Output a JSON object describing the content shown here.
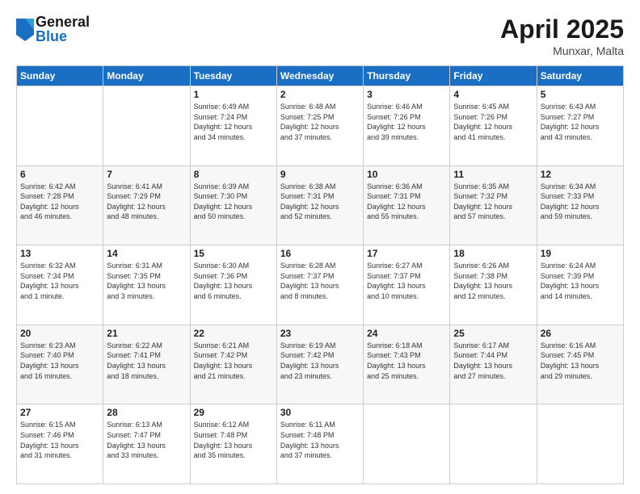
{
  "header": {
    "logo_general": "General",
    "logo_blue": "Blue",
    "title": "April 2025",
    "subtitle": "Munxar, Malta"
  },
  "days_of_week": [
    "Sunday",
    "Monday",
    "Tuesday",
    "Wednesday",
    "Thursday",
    "Friday",
    "Saturday"
  ],
  "weeks": [
    [
      {
        "day": "",
        "info": ""
      },
      {
        "day": "",
        "info": ""
      },
      {
        "day": "1",
        "info": "Sunrise: 6:49 AM\nSunset: 7:24 PM\nDaylight: 12 hours\nand 34 minutes."
      },
      {
        "day": "2",
        "info": "Sunrise: 6:48 AM\nSunset: 7:25 PM\nDaylight: 12 hours\nand 37 minutes."
      },
      {
        "day": "3",
        "info": "Sunrise: 6:46 AM\nSunset: 7:26 PM\nDaylight: 12 hours\nand 39 minutes."
      },
      {
        "day": "4",
        "info": "Sunrise: 6:45 AM\nSunset: 7:26 PM\nDaylight: 12 hours\nand 41 minutes."
      },
      {
        "day": "5",
        "info": "Sunrise: 6:43 AM\nSunset: 7:27 PM\nDaylight: 12 hours\nand 43 minutes."
      }
    ],
    [
      {
        "day": "6",
        "info": "Sunrise: 6:42 AM\nSunset: 7:28 PM\nDaylight: 12 hours\nand 46 minutes."
      },
      {
        "day": "7",
        "info": "Sunrise: 6:41 AM\nSunset: 7:29 PM\nDaylight: 12 hours\nand 48 minutes."
      },
      {
        "day": "8",
        "info": "Sunrise: 6:39 AM\nSunset: 7:30 PM\nDaylight: 12 hours\nand 50 minutes."
      },
      {
        "day": "9",
        "info": "Sunrise: 6:38 AM\nSunset: 7:31 PM\nDaylight: 12 hours\nand 52 minutes."
      },
      {
        "day": "10",
        "info": "Sunrise: 6:36 AM\nSunset: 7:31 PM\nDaylight: 12 hours\nand 55 minutes."
      },
      {
        "day": "11",
        "info": "Sunrise: 6:35 AM\nSunset: 7:32 PM\nDaylight: 12 hours\nand 57 minutes."
      },
      {
        "day": "12",
        "info": "Sunrise: 6:34 AM\nSunset: 7:33 PM\nDaylight: 12 hours\nand 59 minutes."
      }
    ],
    [
      {
        "day": "13",
        "info": "Sunrise: 6:32 AM\nSunset: 7:34 PM\nDaylight: 13 hours\nand 1 minute."
      },
      {
        "day": "14",
        "info": "Sunrise: 6:31 AM\nSunset: 7:35 PM\nDaylight: 13 hours\nand 3 minutes."
      },
      {
        "day": "15",
        "info": "Sunrise: 6:30 AM\nSunset: 7:36 PM\nDaylight: 13 hours\nand 6 minutes."
      },
      {
        "day": "16",
        "info": "Sunrise: 6:28 AM\nSunset: 7:37 PM\nDaylight: 13 hours\nand 8 minutes."
      },
      {
        "day": "17",
        "info": "Sunrise: 6:27 AM\nSunset: 7:37 PM\nDaylight: 13 hours\nand 10 minutes."
      },
      {
        "day": "18",
        "info": "Sunrise: 6:26 AM\nSunset: 7:38 PM\nDaylight: 13 hours\nand 12 minutes."
      },
      {
        "day": "19",
        "info": "Sunrise: 6:24 AM\nSunset: 7:39 PM\nDaylight: 13 hours\nand 14 minutes."
      }
    ],
    [
      {
        "day": "20",
        "info": "Sunrise: 6:23 AM\nSunset: 7:40 PM\nDaylight: 13 hours\nand 16 minutes."
      },
      {
        "day": "21",
        "info": "Sunrise: 6:22 AM\nSunset: 7:41 PM\nDaylight: 13 hours\nand 18 minutes."
      },
      {
        "day": "22",
        "info": "Sunrise: 6:21 AM\nSunset: 7:42 PM\nDaylight: 13 hours\nand 21 minutes."
      },
      {
        "day": "23",
        "info": "Sunrise: 6:19 AM\nSunset: 7:42 PM\nDaylight: 13 hours\nand 23 minutes."
      },
      {
        "day": "24",
        "info": "Sunrise: 6:18 AM\nSunset: 7:43 PM\nDaylight: 13 hours\nand 25 minutes."
      },
      {
        "day": "25",
        "info": "Sunrise: 6:17 AM\nSunset: 7:44 PM\nDaylight: 13 hours\nand 27 minutes."
      },
      {
        "day": "26",
        "info": "Sunrise: 6:16 AM\nSunset: 7:45 PM\nDaylight: 13 hours\nand 29 minutes."
      }
    ],
    [
      {
        "day": "27",
        "info": "Sunrise: 6:15 AM\nSunset: 7:46 PM\nDaylight: 13 hours\nand 31 minutes."
      },
      {
        "day": "28",
        "info": "Sunrise: 6:13 AM\nSunset: 7:47 PM\nDaylight: 13 hours\nand 33 minutes."
      },
      {
        "day": "29",
        "info": "Sunrise: 6:12 AM\nSunset: 7:48 PM\nDaylight: 13 hours\nand 35 minutes."
      },
      {
        "day": "30",
        "info": "Sunrise: 6:11 AM\nSunset: 7:48 PM\nDaylight: 13 hours\nand 37 minutes."
      },
      {
        "day": "",
        "info": ""
      },
      {
        "day": "",
        "info": ""
      },
      {
        "day": "",
        "info": ""
      }
    ]
  ]
}
